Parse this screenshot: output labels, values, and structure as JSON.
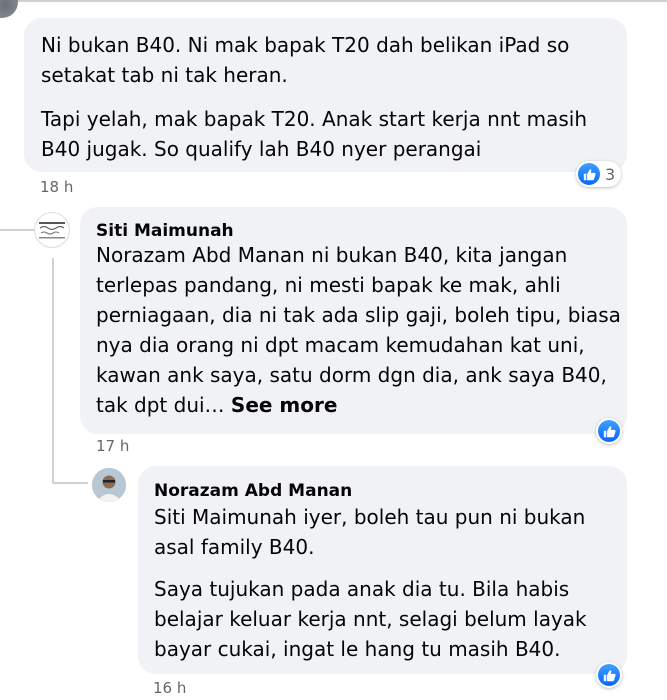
{
  "comments": [
    {
      "author": "",
      "paragraphs": [
        "Ni bukan B40. Ni mak bapak T20 dah belikan iPad so\nsetakat tab ni tak heran.",
        "Tapi yelah, mak bapak T20. Anak start kerja nnt masih\nB40 jugak. So qualify lah B40 nyer perangai"
      ],
      "time": "18 h",
      "reaction_icon": "like-icon",
      "reaction_count": "3"
    },
    {
      "author": "Siti Maimunah",
      "paragraphs": [
        "Norazam Abd Manan ni bukan B40, kita jangan\nterlepas pandang, ni mesti bapak ke mak, ahli\nperniagaan, dia ni tak ada slip gaji, boleh tipu, biasa\nnya dia orang ni dpt macam kemudahan kat uni,\nkawan ank saya, satu dorm dgn dia, ank saya B40,\ntak dpt dui… "
      ],
      "see_more": "See more",
      "time": "17 h",
      "reaction_icon": "like-icon"
    },
    {
      "author": "Norazam Abd Manan",
      "paragraphs": [
        "Siti Maimunah iyer, boleh tau pun ni bukan\nasal family B40.",
        "Saya tujukan pada anak dia tu. Bila habis\nbelajar keluar kerja nnt, selagi belum layak\nbayar cukai, ingat le hang tu masih B40."
      ],
      "time": "16 h",
      "reaction_icon": "like-icon"
    }
  ],
  "colors": {
    "bubble": "#f0f2f5",
    "text": "#050505",
    "meta": "#65676b",
    "like_blue": "#0866ff",
    "thread_line": "#ced0d4"
  }
}
